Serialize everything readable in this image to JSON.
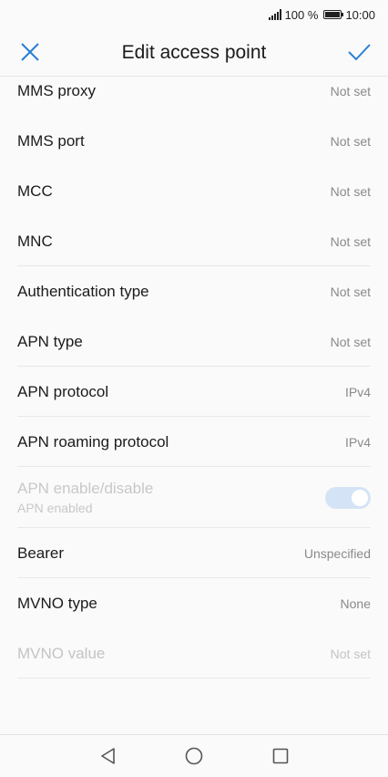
{
  "status_bar": {
    "battery_percent": "100 %",
    "time": "10:00"
  },
  "app_bar": {
    "title": "Edit access point",
    "close_icon": "close-icon",
    "save_icon": "check-icon",
    "accent_color": "#2a7fd4"
  },
  "settings": [
    {
      "label": "MMS proxy",
      "value": "Not set"
    },
    {
      "label": "MMS port",
      "value": "Not set"
    },
    {
      "label": "MCC",
      "value": "Not set"
    },
    {
      "label": "MNC",
      "value": "Not set"
    },
    {
      "label": "Authentication type",
      "value": "Not set"
    },
    {
      "label": "APN type",
      "value": "Not set"
    },
    {
      "label": "APN protocol",
      "value": "IPv4"
    },
    {
      "label": "APN roaming protocol",
      "value": "IPv4"
    },
    {
      "label": "APN enable/disable",
      "sublabel": "APN enabled",
      "toggle_on": true
    },
    {
      "label": "Bearer",
      "value": "Unspecified"
    },
    {
      "label": "MVNO type",
      "value": "None"
    },
    {
      "label": "MVNO value",
      "value": "Not set"
    }
  ],
  "nav_bar": {
    "back_icon": "back-triangle-icon",
    "home_icon": "home-circle-icon",
    "recents_icon": "recents-square-icon"
  }
}
